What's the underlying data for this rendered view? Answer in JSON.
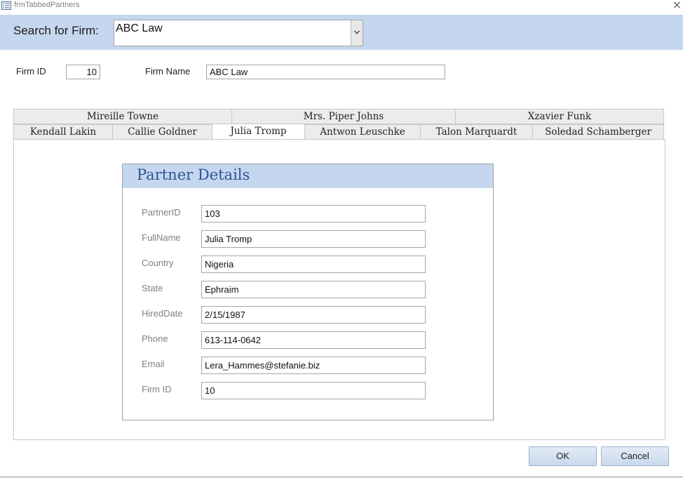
{
  "window": {
    "title": "frmTabbedPartners",
    "close_glyph": "×",
    "icon": "form-icon"
  },
  "search": {
    "label": "Search for Firm:",
    "value": "ABC Law",
    "dropdown_icon": "chevron-down-icon"
  },
  "firm": {
    "id_label": "Firm ID",
    "id_value": "10",
    "name_label": "Firm Name",
    "name_value": "ABC Law"
  },
  "tabs_row1": [
    "Mireille Towne",
    "Mrs. Piper Johns",
    "Xzavier Funk"
  ],
  "tabs_row2": [
    "Kendall Lakin",
    "Callie Goldner",
    "Julia Tromp",
    "Antwon Leuschke",
    "Talon Marquardt",
    "Soledad Schamberger"
  ],
  "active_tab": "Julia Tromp",
  "details": {
    "title": "Partner Details",
    "fields": [
      {
        "label": "PartnerID",
        "value": "103"
      },
      {
        "label": "FullName",
        "value": "Julia Tromp"
      },
      {
        "label": "Country",
        "value": "Nigeria"
      },
      {
        "label": "State",
        "value": "Ephraim"
      },
      {
        "label": "HiredDate",
        "value": "2/15/1987"
      },
      {
        "label": "Phone",
        "value": "613-114-0642"
      },
      {
        "label": "Email",
        "value": "Lera_Hammes@stefanie.biz"
      },
      {
        "label": "Firm ID",
        "value": "10"
      }
    ]
  },
  "buttons": {
    "ok": "OK",
    "cancel": "Cancel"
  },
  "colors": {
    "band": "#c5d7ee",
    "title_blue": "#2f5597",
    "label_gray": "#808080"
  }
}
